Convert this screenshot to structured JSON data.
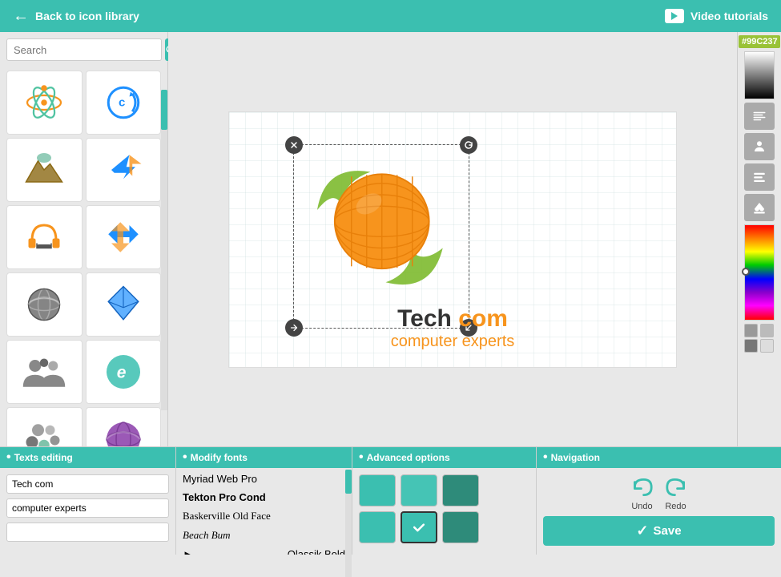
{
  "topbar": {
    "back_label": "Back to icon library",
    "video_label": "Video tutorials"
  },
  "search": {
    "placeholder": "Search"
  },
  "canvas": {
    "title_black": "Tech ",
    "title_orange": "com",
    "subtitle": "computer experts"
  },
  "color_hex": "#99C237",
  "bottom": {
    "texts_panel": {
      "header": "Texts editing",
      "input1_value": "Tech com",
      "input2_value": "computer experts",
      "input3_value": ""
    },
    "fonts_panel": {
      "header": "Modify fonts",
      "fonts": [
        {
          "name": "Myriad Web Pro",
          "style": "normal"
        },
        {
          "name": "Tekton Pro Cond",
          "style": "normal"
        },
        {
          "name": "Baskerville Old Face",
          "style": "normal"
        },
        {
          "name": "Beach Bum",
          "style": "italic"
        },
        {
          "name": "Qlassik Bold",
          "style": "normal",
          "arrow": true
        }
      ]
    },
    "advanced_panel": {
      "header": "Advanced options",
      "swatches_row1": [
        "#3bbfb0",
        "#48c9b0",
        "#2e8b7a"
      ],
      "swatches_row2": [
        "#3bbfb0",
        "#3bbfb0_check",
        "#2e8b7a"
      ]
    },
    "nav_panel": {
      "header": "Navigation",
      "undo_label": "Undo",
      "redo_label": "Redo",
      "save_label": "Save"
    }
  }
}
